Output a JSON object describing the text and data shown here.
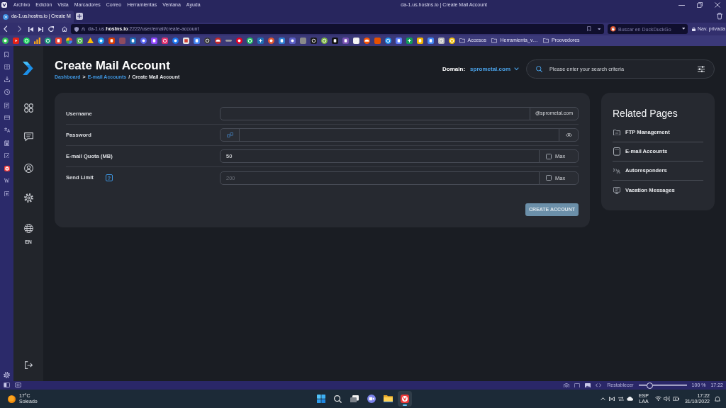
{
  "browser": {
    "menu": [
      "Archivo",
      "Edición",
      "Vista",
      "Marcadores",
      "Correo",
      "Herramientas",
      "Ventana",
      "Ayuda"
    ],
    "window_title": "da-1.us.hostns.io | Create Mail Account",
    "tabs": [
      {
        "title": "da-1.us.hostns.io | Create M",
        "selected": true
      }
    ],
    "address": "da-1.us.**hostns.io**:2222/user/email/create-account",
    "search": {
      "placeholder": "Buscar en DuckDuckGo"
    },
    "private_label": "Nav. privada",
    "bookmark_folders": [
      "Accesos",
      "Herramienta_v…",
      "Proovedores"
    ],
    "panel_letter": "W",
    "status": {
      "reset_label": "Restablecer",
      "zoom": {
        "level": 0.2
      },
      "zoom_text": "100 %",
      "clock": "17:22"
    }
  },
  "page": {
    "sidebar": {
      "language": "EN"
    },
    "title": "Create Mail Account",
    "breadcrumb": [
      {
        "kind": "link",
        "text": "Dashboard"
      },
      {
        "kind": "separator",
        "text": ">"
      },
      {
        "kind": "link",
        "text": "E-mail Accounts"
      },
      {
        "kind": "separator",
        "text": "/"
      },
      {
        "kind": "current",
        "text": "Create Mail Account"
      }
    ],
    "domain_label": "Domain:",
    "domain": "sprometal.com",
    "search": {
      "placeholder": "Please enter your search criteria"
    },
    "form": {
      "rows": [
        {
          "kind": "suffix",
          "label": "Username",
          "suffix": "@sprometal.com"
        },
        {
          "kind": "password",
          "label": "Password"
        },
        {
          "kind": "max",
          "label": "E-mail Quota (MB)",
          "value": "50",
          "max_label": "Max",
          "checked": false
        },
        {
          "kind": "max",
          "label": "Send Limit",
          "help": "?",
          "placeholder": "200",
          "max_label": "Max",
          "checked": false
        }
      ],
      "submit": {
        "label": "CREATE ACCOUNT",
        "disabled": true
      }
    },
    "related": {
      "title": "Related Pages",
      "items": [
        {
          "kind": "ftp",
          "label": "FTP Management"
        },
        {
          "kind": "mail",
          "label": "E-mail Accounts"
        },
        {
          "kind": "autoresponder",
          "label": "Autoresponders"
        },
        {
          "kind": "vacation",
          "label": "Vacation Messages"
        }
      ]
    }
  },
  "taskbar": {
    "weather": {
      "temperature": "17°C",
      "condition": "Soleado"
    },
    "apps": [
      {
        "kind": "start",
        "selected": false
      },
      {
        "kind": "search",
        "selected": false
      },
      {
        "kind": "task_view",
        "selected": false
      },
      {
        "kind": "chat",
        "selected": false
      },
      {
        "kind": "explorer",
        "selected": false
      },
      {
        "kind": "browser",
        "selected": true
      }
    ],
    "input_language": [
      "ESP",
      "LAA"
    ],
    "time": "17:22",
    "date": "31/10/2022"
  }
}
